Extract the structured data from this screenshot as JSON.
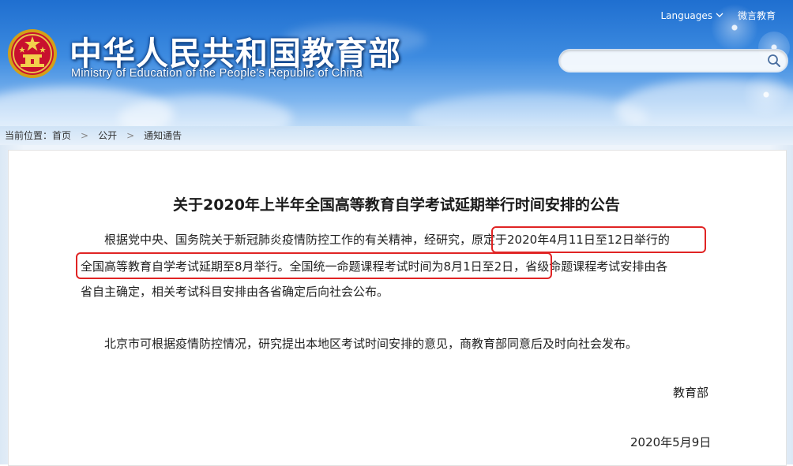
{
  "header": {
    "title_cn": "中华人民共和国教育部",
    "title_en": "Ministry of Education of the People's Republic of China",
    "languages_label": "Languages",
    "weibo_label": "微言教育",
    "search": {
      "placeholder": "",
      "value": ""
    },
    "emblem_icon": "national-emblem-icon",
    "colors": {
      "sky": "#3d8be0",
      "highlight": "#e02424"
    }
  },
  "breadcrumb": {
    "label": "当前位置：",
    "items": [
      "首页",
      "公开",
      "通知通告"
    ],
    "separator": ">"
  },
  "article": {
    "title": "关于2020年上半年全国高等教育自学考试延期举行时间安排的公告",
    "paragraph1": {
      "line1_pre": "根据党中央、国务院关于新冠肺炎疫情防控工作的有关精神，经研究，",
      "line1_highlight": "原定于2020年4月11日至12日举行的",
      "line2_highlight": "全国高等教育自学考试延期至8月举行。全国统一命题课程考试时间为8月1日至2日，",
      "line2_post": "省级命题课程考试安排由各",
      "line3": "省自主确定，相关考试科目安排由各省确定后向社会公布。"
    },
    "paragraph2": "北京市可根据疫情防控情况，研究提出本地区考试时间安排的意见，商教育部同意后及时向社会发布。",
    "signature": "教育部",
    "date": "2020年5月9日"
  }
}
